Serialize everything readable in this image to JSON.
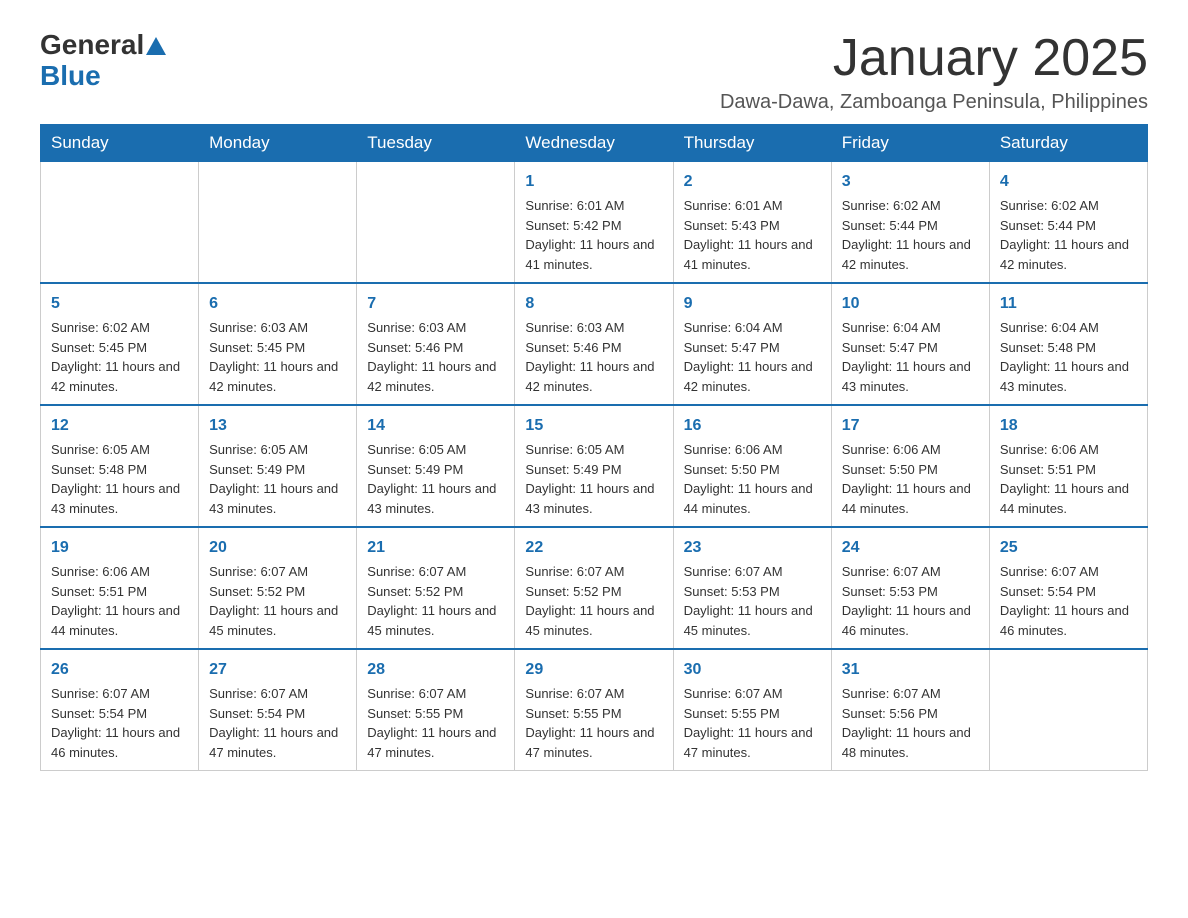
{
  "logo": {
    "text_general": "General",
    "text_blue": "Blue"
  },
  "header": {
    "month": "January 2025",
    "location": "Dawa-Dawa, Zamboanga Peninsula, Philippines"
  },
  "days_of_week": [
    "Sunday",
    "Monday",
    "Tuesday",
    "Wednesday",
    "Thursday",
    "Friday",
    "Saturday"
  ],
  "weeks": [
    {
      "days": [
        {
          "number": "",
          "info": ""
        },
        {
          "number": "",
          "info": ""
        },
        {
          "number": "",
          "info": ""
        },
        {
          "number": "1",
          "info": "Sunrise: 6:01 AM\nSunset: 5:42 PM\nDaylight: 11 hours and 41 minutes."
        },
        {
          "number": "2",
          "info": "Sunrise: 6:01 AM\nSunset: 5:43 PM\nDaylight: 11 hours and 41 minutes."
        },
        {
          "number": "3",
          "info": "Sunrise: 6:02 AM\nSunset: 5:44 PM\nDaylight: 11 hours and 42 minutes."
        },
        {
          "number": "4",
          "info": "Sunrise: 6:02 AM\nSunset: 5:44 PM\nDaylight: 11 hours and 42 minutes."
        }
      ]
    },
    {
      "days": [
        {
          "number": "5",
          "info": "Sunrise: 6:02 AM\nSunset: 5:45 PM\nDaylight: 11 hours and 42 minutes."
        },
        {
          "number": "6",
          "info": "Sunrise: 6:03 AM\nSunset: 5:45 PM\nDaylight: 11 hours and 42 minutes."
        },
        {
          "number": "7",
          "info": "Sunrise: 6:03 AM\nSunset: 5:46 PM\nDaylight: 11 hours and 42 minutes."
        },
        {
          "number": "8",
          "info": "Sunrise: 6:03 AM\nSunset: 5:46 PM\nDaylight: 11 hours and 42 minutes."
        },
        {
          "number": "9",
          "info": "Sunrise: 6:04 AM\nSunset: 5:47 PM\nDaylight: 11 hours and 42 minutes."
        },
        {
          "number": "10",
          "info": "Sunrise: 6:04 AM\nSunset: 5:47 PM\nDaylight: 11 hours and 43 minutes."
        },
        {
          "number": "11",
          "info": "Sunrise: 6:04 AM\nSunset: 5:48 PM\nDaylight: 11 hours and 43 minutes."
        }
      ]
    },
    {
      "days": [
        {
          "number": "12",
          "info": "Sunrise: 6:05 AM\nSunset: 5:48 PM\nDaylight: 11 hours and 43 minutes."
        },
        {
          "number": "13",
          "info": "Sunrise: 6:05 AM\nSunset: 5:49 PM\nDaylight: 11 hours and 43 minutes."
        },
        {
          "number": "14",
          "info": "Sunrise: 6:05 AM\nSunset: 5:49 PM\nDaylight: 11 hours and 43 minutes."
        },
        {
          "number": "15",
          "info": "Sunrise: 6:05 AM\nSunset: 5:49 PM\nDaylight: 11 hours and 43 minutes."
        },
        {
          "number": "16",
          "info": "Sunrise: 6:06 AM\nSunset: 5:50 PM\nDaylight: 11 hours and 44 minutes."
        },
        {
          "number": "17",
          "info": "Sunrise: 6:06 AM\nSunset: 5:50 PM\nDaylight: 11 hours and 44 minutes."
        },
        {
          "number": "18",
          "info": "Sunrise: 6:06 AM\nSunset: 5:51 PM\nDaylight: 11 hours and 44 minutes."
        }
      ]
    },
    {
      "days": [
        {
          "number": "19",
          "info": "Sunrise: 6:06 AM\nSunset: 5:51 PM\nDaylight: 11 hours and 44 minutes."
        },
        {
          "number": "20",
          "info": "Sunrise: 6:07 AM\nSunset: 5:52 PM\nDaylight: 11 hours and 45 minutes."
        },
        {
          "number": "21",
          "info": "Sunrise: 6:07 AM\nSunset: 5:52 PM\nDaylight: 11 hours and 45 minutes."
        },
        {
          "number": "22",
          "info": "Sunrise: 6:07 AM\nSunset: 5:52 PM\nDaylight: 11 hours and 45 minutes."
        },
        {
          "number": "23",
          "info": "Sunrise: 6:07 AM\nSunset: 5:53 PM\nDaylight: 11 hours and 45 minutes."
        },
        {
          "number": "24",
          "info": "Sunrise: 6:07 AM\nSunset: 5:53 PM\nDaylight: 11 hours and 46 minutes."
        },
        {
          "number": "25",
          "info": "Sunrise: 6:07 AM\nSunset: 5:54 PM\nDaylight: 11 hours and 46 minutes."
        }
      ]
    },
    {
      "days": [
        {
          "number": "26",
          "info": "Sunrise: 6:07 AM\nSunset: 5:54 PM\nDaylight: 11 hours and 46 minutes."
        },
        {
          "number": "27",
          "info": "Sunrise: 6:07 AM\nSunset: 5:54 PM\nDaylight: 11 hours and 47 minutes."
        },
        {
          "number": "28",
          "info": "Sunrise: 6:07 AM\nSunset: 5:55 PM\nDaylight: 11 hours and 47 minutes."
        },
        {
          "number": "29",
          "info": "Sunrise: 6:07 AM\nSunset: 5:55 PM\nDaylight: 11 hours and 47 minutes."
        },
        {
          "number": "30",
          "info": "Sunrise: 6:07 AM\nSunset: 5:55 PM\nDaylight: 11 hours and 47 minutes."
        },
        {
          "number": "31",
          "info": "Sunrise: 6:07 AM\nSunset: 5:56 PM\nDaylight: 11 hours and 48 minutes."
        },
        {
          "number": "",
          "info": ""
        }
      ]
    }
  ]
}
